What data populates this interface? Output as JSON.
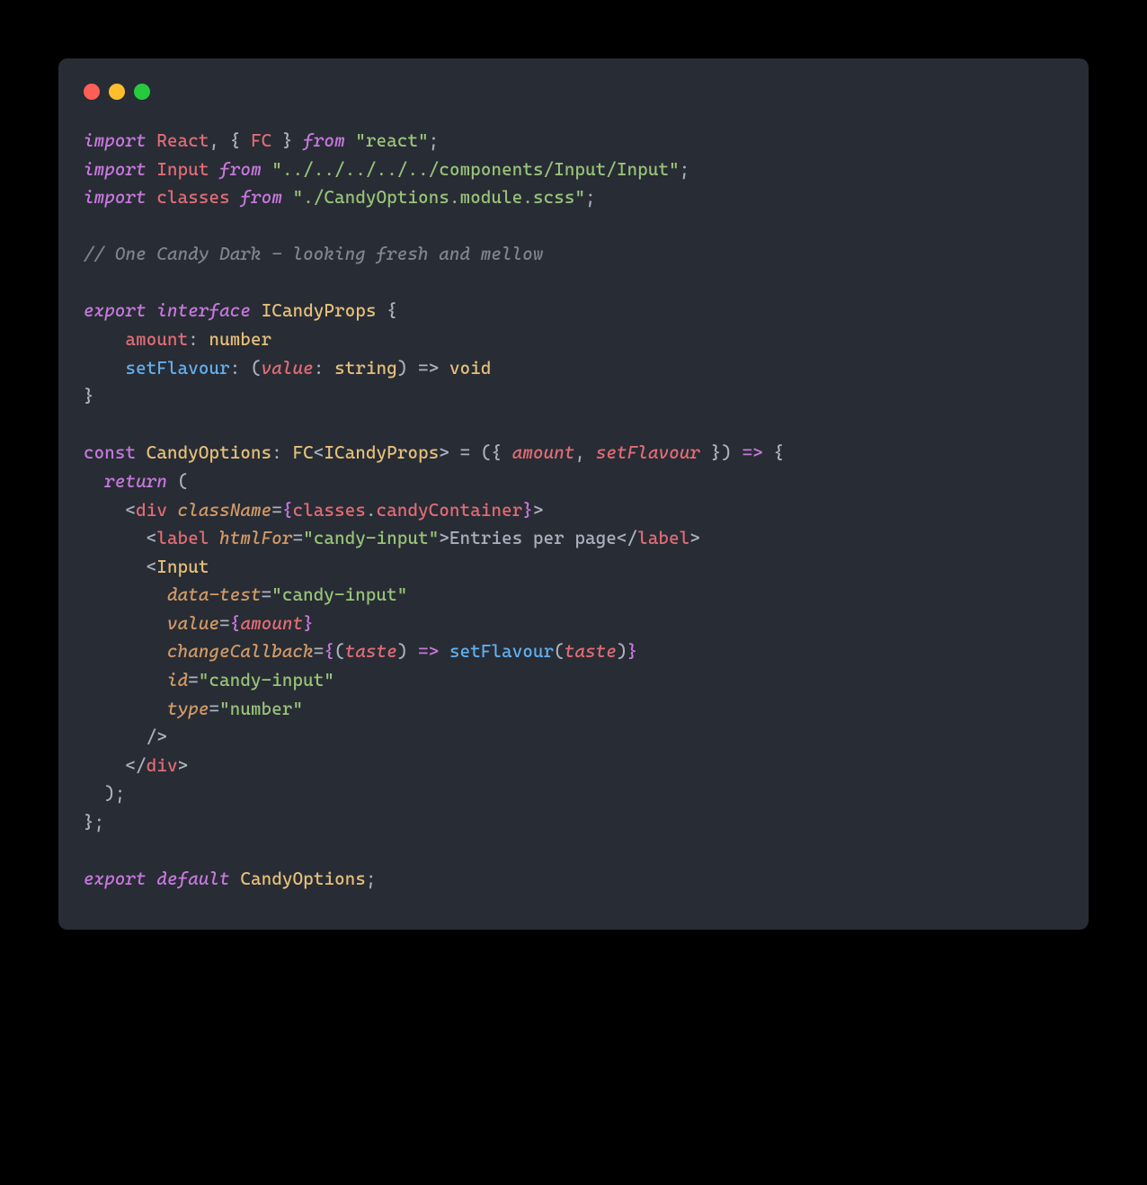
{
  "window": {
    "traffic_lights": {
      "red": "#ff5f56",
      "yellow": "#ffbd2e",
      "green": "#27c93f"
    }
  },
  "theme": {
    "background": "#282c34",
    "foreground": "#abb2bf",
    "purple": "#c678dd",
    "red": "#e06c75",
    "blue": "#61afef",
    "yellow": "#e5c07b",
    "green": "#98c379",
    "orange": "#d19a66",
    "comment": "#7f848e"
  },
  "code": {
    "import1": {
      "kw_import": "import",
      "react": "React",
      "comma_brace": ", { ",
      "fc": "FC",
      "brace_close": " } ",
      "kw_from": "from",
      "str": "\"react\"",
      "semi": ";"
    },
    "import2": {
      "kw_import": "import",
      "input": "Input",
      "kw_from": "from",
      "str": "\"../../../../../components/Input/Input\"",
      "semi": ";"
    },
    "import3": {
      "kw_import": "import",
      "classes": "classes",
      "kw_from": "from",
      "str": "\"./CandyOptions.module.scss\"",
      "semi": ";"
    },
    "comment": "// One Candy Dark - looking fresh and mellow",
    "export_interface": {
      "kw_export": "export",
      "kw_interface": "interface",
      "name": "ICandyProps",
      "brace": " {"
    },
    "field_amount": {
      "indent": "    ",
      "name": "amount",
      "colon": ": ",
      "type": "number"
    },
    "field_setFlavour": {
      "indent": "    ",
      "name": "setFlavour",
      "colon": ": (",
      "param": "value",
      "param_colon": ": ",
      "param_type": "string",
      "arrow": ") => ",
      "ret": "void"
    },
    "brace_close": "}",
    "const_decl": {
      "kw_const": "const",
      "name": "CandyOptions",
      "colon": ": ",
      "fc": "FC",
      "lt": "<",
      "generic": "ICandyProps",
      "gt": ">",
      "eq": " = ",
      "destruct_open": "({ ",
      "p1": "amount",
      "comma": ", ",
      "p2": "setFlavour",
      "destruct_close": " }) ",
      "arrow": "=>",
      "brace": " {"
    },
    "return_line": {
      "indent": "  ",
      "kw_return": "return",
      "paren": " ("
    },
    "jsx_div_open": {
      "indent": "    <",
      "tag": "div",
      "space": " ",
      "attr": "className",
      "eq": "=",
      "brace_open": "{",
      "obj": "classes",
      "dot": ".",
      "prop": "candyContainer",
      "brace_close": "}",
      "gt": ">"
    },
    "jsx_label": {
      "indent": "      <",
      "tag": "label",
      "space": " ",
      "attr": "htmlFor",
      "eq": "=",
      "str": "\"candy-input\"",
      "gt": ">",
      "text": "Entries per page",
      "close_open": "</",
      "close_tag": "label",
      "close_gt": ">"
    },
    "jsx_input_open": {
      "indent": "      <",
      "tag": "Input"
    },
    "jsx_attr_datatest": {
      "indent": "        ",
      "attr": "data-test",
      "eq": "=",
      "str": "\"candy-input\""
    },
    "jsx_attr_value": {
      "indent": "        ",
      "attr": "value",
      "eq": "=",
      "brace_open": "{",
      "expr": "amount",
      "brace_close": "}"
    },
    "jsx_attr_cb": {
      "indent": "        ",
      "attr": "changeCallback",
      "eq": "=",
      "brace_open": "{",
      "paren_open": "(",
      "param": "taste",
      "paren_close": ") ",
      "arrow": "=>",
      "space": " ",
      "fn": "setFlavour",
      "call_open": "(",
      "arg": "taste",
      "call_close": ")",
      "brace_close": "}"
    },
    "jsx_attr_id": {
      "indent": "        ",
      "attr": "id",
      "eq": "=",
      "str": "\"candy-input\""
    },
    "jsx_attr_type": {
      "indent": "        ",
      "attr": "type",
      "eq": "=",
      "str": "\"number\""
    },
    "jsx_input_close": {
      "indent": "      />"
    },
    "jsx_div_close": {
      "indent": "    </",
      "tag": "div",
      "gt": ">"
    },
    "return_close": {
      "indent": "  );"
    },
    "fn_close": "};",
    "export_default": {
      "kw_export": "export",
      "kw_default": "default",
      "name": "CandyOptions",
      "semi": ";"
    }
  }
}
